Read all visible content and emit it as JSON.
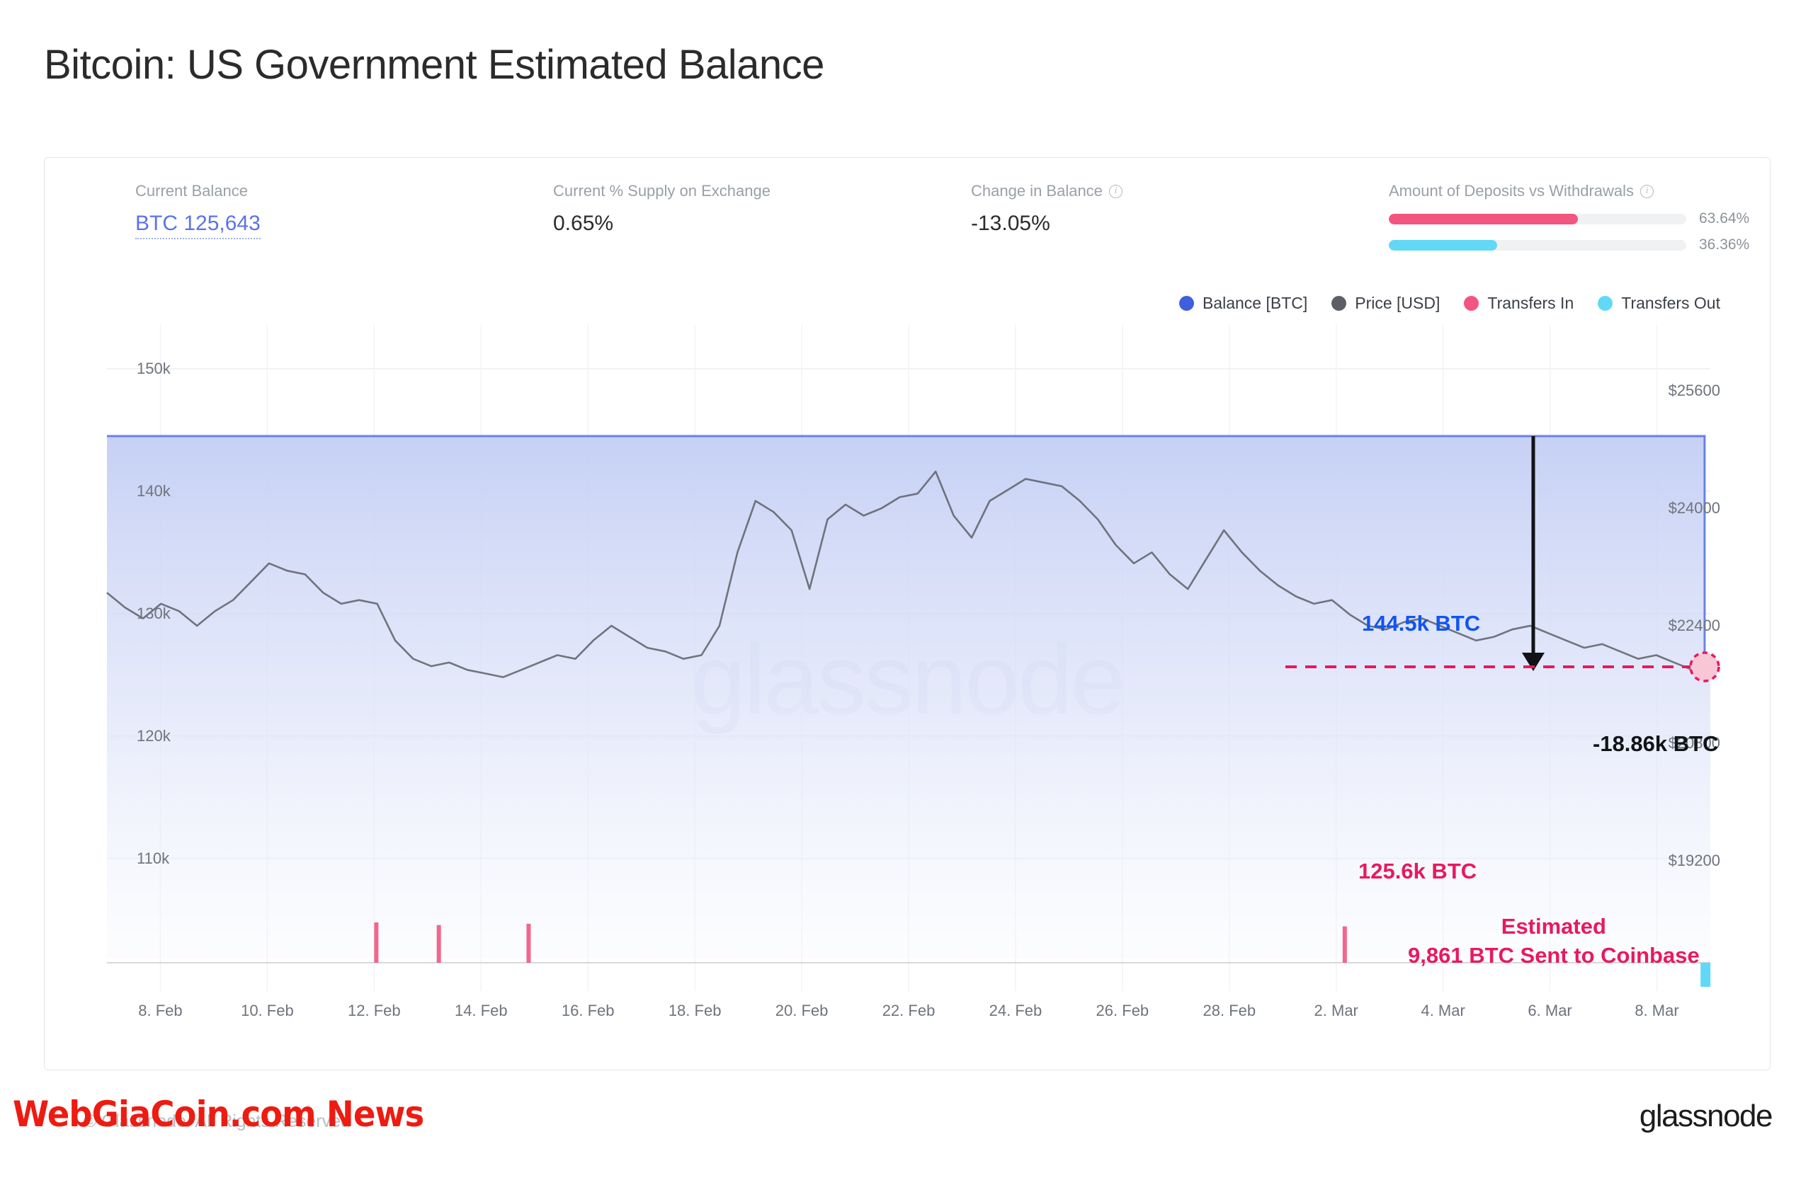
{
  "title": "Bitcoin: US Government Estimated Balance",
  "stats": [
    {
      "label": "Current Balance",
      "value": "BTC 125,643",
      "has_info": false,
      "is_link": true
    },
    {
      "label": "Current % Supply on Exchange",
      "value": "0.65%",
      "has_info": false,
      "is_link": false
    },
    {
      "label": "Change in Balance",
      "value": "-13.05%",
      "has_info": true,
      "is_link": false
    }
  ],
  "deposits": {
    "label": "Amount of Deposits vs Withdrawals",
    "has_info": true,
    "rows": [
      {
        "name": "deposits",
        "pct_label": "63.64%",
        "pct": 63.64,
        "color": "#f4traits"
      },
      {
        "name": "withdrawals",
        "pct_label": "36.36%",
        "pct": 36.36,
        "color": "#6fd8f5"
      }
    ],
    "deposits_pct_label": "63.64%",
    "withdrawals_pct_label": "36.36%"
  },
  "legend": [
    {
      "label": "Balance [BTC]",
      "color": "#3f5fe0"
    },
    {
      "label": "Price [USD]",
      "color": "#5c6066"
    },
    {
      "label": "Transfers In",
      "color": "#f2557f"
    },
    {
      "label": "Transfers Out",
      "color": "#62d8f7"
    }
  ],
  "annotations": {
    "balance_high": "144.5k BTC",
    "balance_low": "125.6k BTC",
    "delta": "-18.86k BTC",
    "estimated_line1": "Estimated",
    "estimated_line2": "9,861 BTC Sent to Coinbase"
  },
  "footer": {
    "copyright": "© Glassnode. All Rights Reserved",
    "news_stamp": "WebGiaCoin.com News",
    "brand": "glassnode"
  },
  "colors": {
    "balance_blue": "#3f5fe0",
    "price_gray": "#5c6066",
    "transfers_in_pink": "#f2557f",
    "transfers_out_cyan": "#62d8f7",
    "annotation_pink": "#e8195e",
    "annotation_blue": "#1155ee"
  },
  "chart_data": {
    "type": "line",
    "title": "Bitcoin: US Government Estimated Balance",
    "xlabel": "",
    "ylabel": "Balance [BTC]",
    "y2label": "Price [USD]",
    "grid": true,
    "legend_position": "top-right",
    "watermark": "glassnode",
    "x_tick_labels": [
      "8. Feb",
      "10. Feb",
      "12. Feb",
      "14. Feb",
      "16. Feb",
      "18. Feb",
      "20. Feb",
      "22. Feb",
      "24. Feb",
      "26. Feb",
      "28. Feb",
      "2. Mar",
      "4. Mar",
      "6. Mar",
      "8. Mar"
    ],
    "y_left_ticks": [
      "150k",
      "140k",
      "130k",
      "120k",
      "110k"
    ],
    "y_left_values": [
      150000,
      140000,
      130000,
      120000,
      110000
    ],
    "ylim_left": [
      105000,
      153000
    ],
    "y_right_ticks": [
      "$25600",
      "$24000",
      "$22400",
      "$20800",
      "$19200"
    ],
    "y_right_values": [
      25600,
      24000,
      22400,
      20800,
      19200
    ],
    "ylim_right": [
      18400,
      26400
    ],
    "series": [
      {
        "name": "Balance [BTC]",
        "color": "#3f5fe0",
        "type": "step-area",
        "axis": "left",
        "values": [
          144500,
          144500,
          144500,
          144500,
          144500,
          144500,
          144500,
          144500,
          144500,
          144500,
          144500,
          144500,
          144500,
          144500,
          144500,
          144500,
          144500,
          144500,
          144500,
          144500,
          144500,
          144500,
          144500,
          144500,
          144500,
          144500,
          144500,
          144500,
          144500,
          125643
        ]
      },
      {
        "name": "Price [USD]",
        "color": "#5c6066",
        "type": "line",
        "axis": "right",
        "values": [
          22850,
          22650,
          22500,
          22700,
          22600,
          22400,
          22600,
          22750,
          23000,
          23250,
          23150,
          23100,
          22850,
          22700,
          22750,
          22700,
          22200,
          21950,
          21850,
          21900,
          21800,
          21750,
          21700,
          21800,
          21900,
          22000,
          21950,
          22200,
          22400,
          22250,
          22100,
          22050,
          21950,
          22000,
          22400,
          23400,
          24100,
          23950,
          23700,
          22900,
          23850,
          24050,
          23900,
          24000,
          24150,
          24200,
          24500,
          23900,
          23600,
          24100,
          24250,
          24400,
          24350,
          24300,
          24100,
          23850,
          23500,
          23250,
          23400,
          23100,
          22900,
          23300,
          23700,
          23400,
          23150,
          22950,
          22800,
          22700,
          22750,
          22550,
          22400,
          22350,
          22450,
          22500,
          22400,
          22300,
          22200,
          22250,
          22350,
          22400,
          22300,
          22200,
          22100,
          22150,
          22050,
          21950,
          22000,
          21900,
          21800,
          21950
        ]
      },
      {
        "name": "Transfers In",
        "color": "#f2557f",
        "type": "bar",
        "axis": "left",
        "spikes": [
          {
            "x_label": "12. Feb",
            "x_frac": 0.168,
            "height_frac": 0.62
          },
          {
            "x_label": "13. Feb",
            "x_frac": 0.207,
            "height_frac": 0.58
          },
          {
            "x_label": "15. Feb",
            "x_frac": 0.263,
            "height_frac": 0.6
          },
          {
            "x_label": "2. Mar",
            "x_frac": 0.772,
            "height_frac": 0.56
          }
        ]
      },
      {
        "name": "Transfers Out",
        "color": "#62d8f7",
        "type": "bar",
        "axis": "left",
        "spikes": [
          {
            "x_label": "8. Mar",
            "x_frac": 0.997,
            "height_frac": 0.95,
            "direction": "down"
          }
        ]
      }
    ],
    "annotations": [
      {
        "text": "144.5k BTC",
        "color": "#1155ee",
        "y_value": 144500
      },
      {
        "text": "125.6k BTC",
        "color": "#e8195e",
        "y_value": 125643
      },
      {
        "text": "-18.86k BTC",
        "color": "#111316",
        "delta_value": -18860
      },
      {
        "text": "Estimated 9,861 BTC Sent to Coinbase",
        "color": "#e8195e"
      }
    ]
  }
}
